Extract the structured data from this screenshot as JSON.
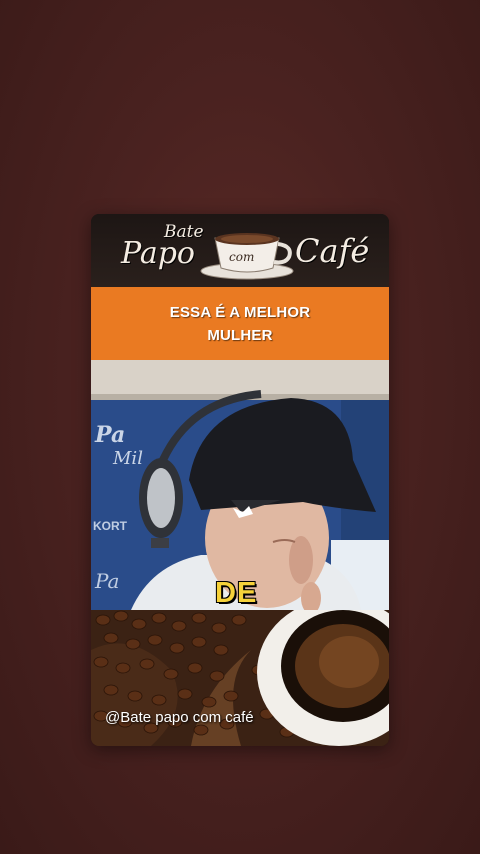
{
  "logo": {
    "bate": "Bate",
    "papo": "Papo",
    "com": "com",
    "cafe": "Café"
  },
  "headline": {
    "line1": "ESSA É A MELHOR",
    "line2": "MULHER"
  },
  "subtitle": "DE",
  "watermark": "@Bate papo com café",
  "colors": {
    "headline_bg": "#ea7a22",
    "subtitle": "#f6d23a",
    "background": "#4a2220"
  }
}
